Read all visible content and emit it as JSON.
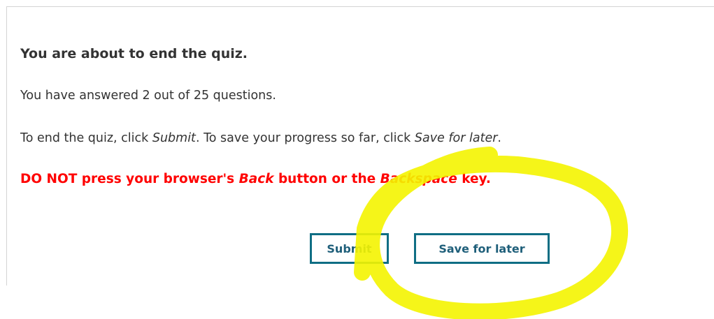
{
  "dialog": {
    "heading": "You are about to end the quiz.",
    "answered": "You have answered 2 out of 25 questions.",
    "instructions": {
      "part1": "To end the quiz, click ",
      "submit_em": "Submit",
      "part2": ". To save your progress so far, click ",
      "save_em": "Save for later",
      "part3": "."
    },
    "warning": {
      "part1": "DO NOT press your browser's ",
      "back_em": "Back",
      "part2": " button or the ",
      "backspace_em": "Backspace",
      "part3": " key."
    },
    "buttons": {
      "submit": "Submit",
      "save_for_later": "Save for later"
    }
  },
  "colors": {
    "text": "#333333",
    "warning": "#ff0000",
    "button_border": "#0f6e84",
    "button_text": "#1f5f7a",
    "highlight": "#f4f400"
  }
}
